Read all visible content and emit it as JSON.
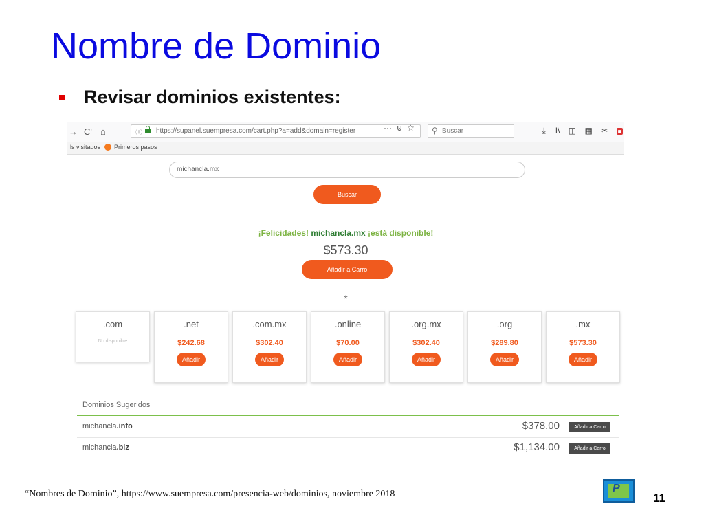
{
  "slide": {
    "title": "Nombre de Dominio",
    "bullet": "Revisar dominios existentes:",
    "footnote": "“Nombres de Dominio”, https://www.suempresa.com/presencia-web/dominios, noviembre 2018",
    "page_number": "11"
  },
  "browser": {
    "url": "https://supanel.suempresa.com/cart.php?a=add&domain=register",
    "search_placeholder": "Buscar",
    "bookmarks": [
      "ls visitados",
      "Primeros pasos"
    ]
  },
  "search": {
    "value": "michancla.mx",
    "button_label": "Buscar"
  },
  "result": {
    "prefix": "¡Felicidades!",
    "domain": "michancla.mx",
    "suffix": "¡está disponible!",
    "price": "$573.30",
    "add_button": "Añadir a Carro",
    "separator": "*"
  },
  "tlds": [
    {
      "name": ".com",
      "status": "No disponible"
    },
    {
      "name": ".net",
      "price": "$242.68",
      "button": "Añadir"
    },
    {
      "name": ".com.mx",
      "price": "$302.40",
      "button": "Añadir"
    },
    {
      "name": ".online",
      "price": "$70.00",
      "button": "Añadir"
    },
    {
      "name": ".org.mx",
      "price": "$302.40",
      "button": "Añadir"
    },
    {
      "name": ".org",
      "price": "$289.80",
      "button": "Añadir"
    },
    {
      "name": ".mx",
      "price": "$573.30",
      "button": "Añadir"
    }
  ],
  "suggested": {
    "title": "Dominios Sugeridos",
    "rows": [
      {
        "name": "michancla",
        "ext": ".info",
        "price": "$378.00",
        "button": "Añadir a Carro"
      },
      {
        "name": "michancla",
        "ext": ".biz",
        "price": "$1,134.00",
        "button": "Añadir a Carro"
      }
    ]
  },
  "colors": {
    "title": "#0a0ae0",
    "accent_orange": "#f05a1e",
    "success_green": "#7cb342",
    "bullet_red": "#e00000"
  },
  "icons": [
    "back-arrow-icon",
    "reload-icon",
    "home-icon",
    "info-icon",
    "lock-icon",
    "more-icon",
    "pocket-icon",
    "bookmark-star-icon",
    "search-icon",
    "download-icon",
    "library-icon",
    "sidebar-icon",
    "reader-icon",
    "extension-icon",
    "firefox-icon",
    "star-separator-icon"
  ]
}
